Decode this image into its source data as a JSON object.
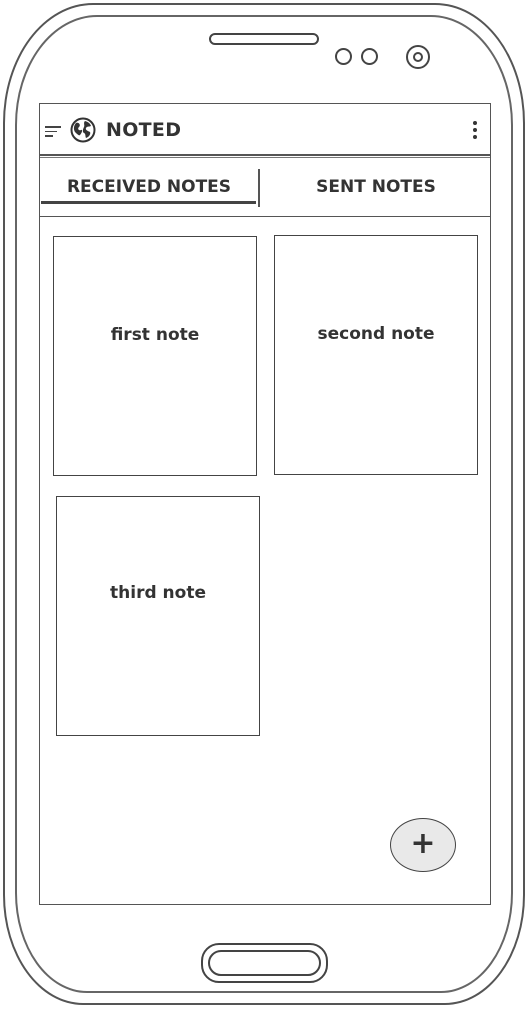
{
  "app": {
    "title": "NOTED",
    "menu_icon": "menu-icon",
    "logo_icon": "globe-icon",
    "overflow_icon": "more-vertical-icon"
  },
  "tabs": [
    {
      "label": "RECEIVED NOTES",
      "selected": true
    },
    {
      "label": "SENT NOTES",
      "selected": false
    }
  ],
  "notes": [
    {
      "title": "first note"
    },
    {
      "title": "second note"
    },
    {
      "title": "third note"
    }
  ],
  "fab": {
    "label": "+",
    "icon": "plus-icon"
  }
}
